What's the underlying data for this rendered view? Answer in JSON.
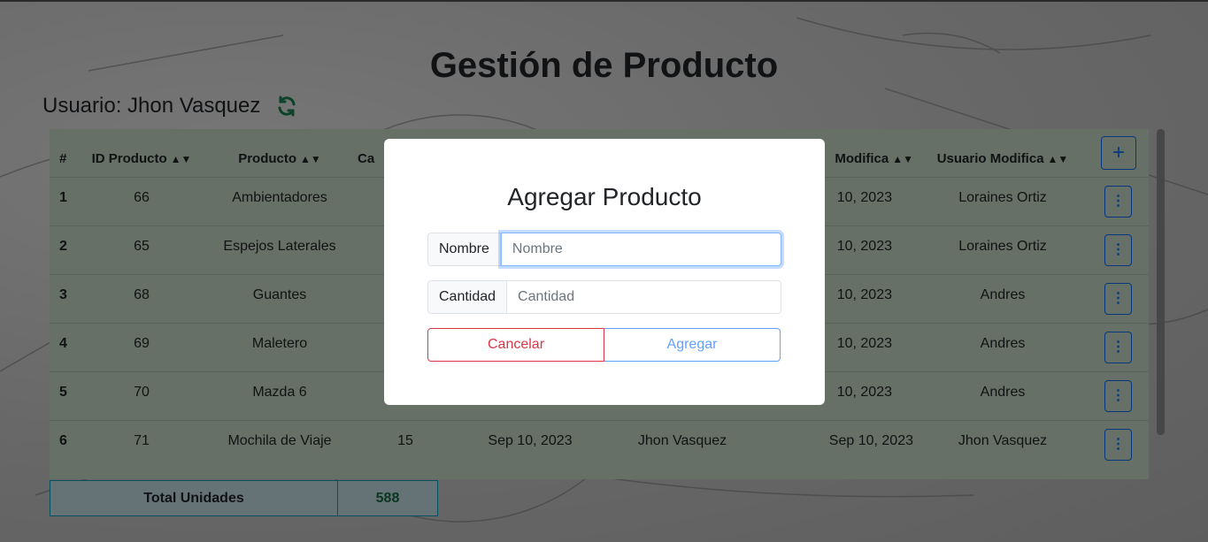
{
  "page": {
    "title": "Gestión de Producto",
    "user_label": "Usuario: Jhon Vasquez"
  },
  "table": {
    "headers": {
      "num": "#",
      "id": "ID Producto",
      "producto": "Producto",
      "cantidad": "Ca",
      "fecha_modifica": "Modifica",
      "usuario_modifica": "Usuario Modifica"
    },
    "add_button": "+",
    "rows": [
      {
        "num": "1",
        "id": "66",
        "producto": "Ambientadores",
        "cantidad": "",
        "fecha_crea": "",
        "usuario_crea": "",
        "fecha_modifica": "10, 2023",
        "usuario_modifica": "Loraines Ortiz"
      },
      {
        "num": "2",
        "id": "65",
        "producto": "Espejos Laterales",
        "cantidad": "",
        "fecha_crea": "",
        "usuario_crea": "",
        "fecha_modifica": "10, 2023",
        "usuario_modifica": "Loraines Ortiz"
      },
      {
        "num": "3",
        "id": "68",
        "producto": "Guantes",
        "cantidad": "",
        "fecha_crea": "",
        "usuario_crea": "",
        "fecha_modifica": "10, 2023",
        "usuario_modifica": "Andres"
      },
      {
        "num": "4",
        "id": "69",
        "producto": "Maletero",
        "cantidad": "",
        "fecha_crea": "",
        "usuario_crea": "",
        "fecha_modifica": "10, 2023",
        "usuario_modifica": "Andres"
      },
      {
        "num": "5",
        "id": "70",
        "producto": "Mazda 6",
        "cantidad": "",
        "fecha_crea": "",
        "usuario_crea": "",
        "fecha_modifica": "10, 2023",
        "usuario_modifica": "Andres"
      },
      {
        "num": "6",
        "id": "71",
        "producto": "Mochila de Viaje",
        "cantidad": "15",
        "fecha_crea": "Sep 10, 2023",
        "usuario_crea": "Jhon Vasquez",
        "fecha_modifica": "Sep 10, 2023",
        "usuario_modifica": "Jhon Vasquez"
      }
    ],
    "row_action_icon": "⋮"
  },
  "total": {
    "label": "Total Unidades",
    "value": "588"
  },
  "modal": {
    "title": "Agregar Producto",
    "nombre_label": "Nombre",
    "nombre_placeholder": "Nombre",
    "cantidad_label": "Cantidad",
    "cantidad_placeholder": "Cantidad",
    "cancel_label": "Cancelar",
    "submit_label": "Agregar"
  },
  "icons": {
    "refresh": "refresh-icon",
    "sort": "sort-icon",
    "kebab": "kebab-menu-icon",
    "plus": "plus-icon"
  },
  "colors": {
    "primary": "#0d6efd",
    "danger": "#dc3545",
    "success": "#198754",
    "table_bg": "#cfe0cc",
    "info_border": "#0aa2c0"
  }
}
